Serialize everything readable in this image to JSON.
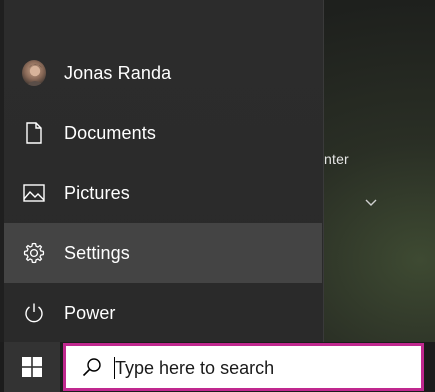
{
  "start_menu": {
    "items": [
      {
        "label": "Jonas Randa",
        "icon": "user-avatar-icon"
      },
      {
        "label": "Documents",
        "icon": "document-icon"
      },
      {
        "label": "Pictures",
        "icon": "picture-icon"
      },
      {
        "label": "Settings",
        "icon": "gear-icon",
        "active": true
      },
      {
        "label": "Power",
        "icon": "power-icon"
      }
    ]
  },
  "background": {
    "partial_text": "nter"
  },
  "taskbar": {
    "start_icon": "windows-logo-icon",
    "search": {
      "placeholder": "Type here to search",
      "icon": "search-icon"
    }
  },
  "colors": {
    "menu_bg": "#2b2b2b",
    "active_item_bg": "#444444",
    "search_border": "#c0288f",
    "taskbar_bg": "#1c1c1c"
  }
}
